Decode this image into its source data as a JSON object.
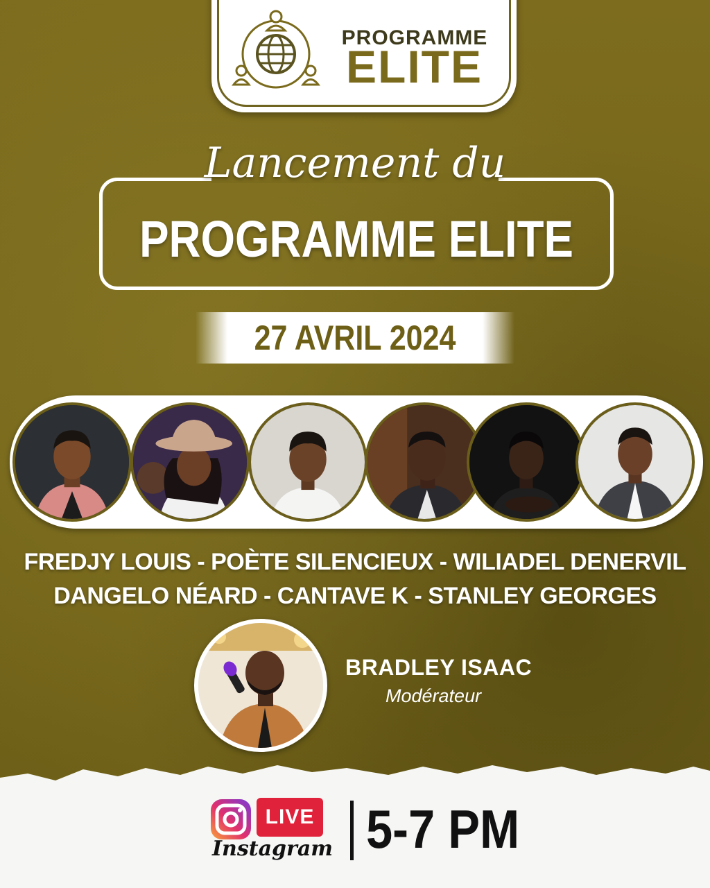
{
  "logo": {
    "line1": "PROGRAMME",
    "line2": "ELITE"
  },
  "heading": {
    "script": "Lancement du",
    "main": "PROGRAMME ELITE"
  },
  "date": "27 AVRIL 2024",
  "speakers": {
    "line1": "FREDJY LOUIS - POÈTE SILENCIEUX - WILIADEL DENERVIL",
    "line2": "DANGELO NÉARD -  CANTAVE K  - STANLEY GEORGES"
  },
  "moderator": {
    "name": "BRADLEY ISAAC",
    "role": "Modérateur"
  },
  "footer": {
    "live": "LIVE",
    "platform": "Instagram",
    "time": "5-7 PM"
  },
  "colors": {
    "olive": "#7a6a1c",
    "dark_olive": "#6e5f16",
    "live_red": "#e0223a",
    "white": "#ffffff"
  }
}
